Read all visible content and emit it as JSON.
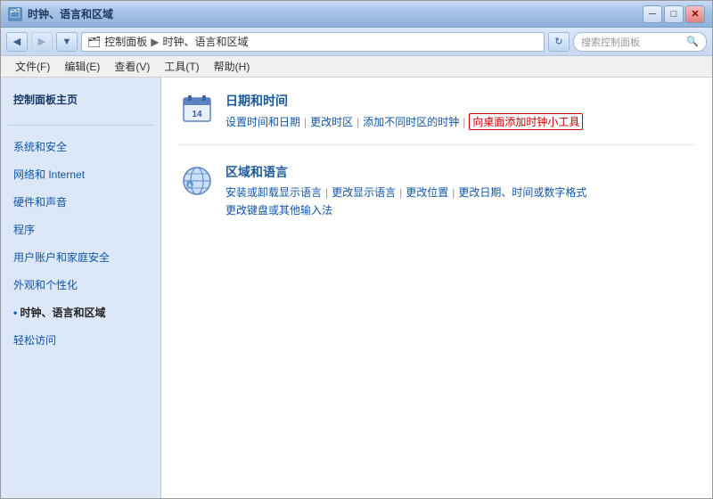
{
  "window": {
    "title": "时钟、语言和区域",
    "title_icon": "🗂"
  },
  "titlebar": {
    "back_btn": "◀",
    "forward_btn": "▶",
    "down_btn": "▼",
    "minimize": "─",
    "maximize": "□",
    "close": "✕"
  },
  "addressbar": {
    "path_prefix": "控制面板",
    "path_separator": "▶",
    "path_current": "时钟、语言和区域",
    "refresh_btn": "↻",
    "search_placeholder": "搜索控制面板",
    "search_icon": "🔍"
  },
  "menubar": {
    "items": [
      {
        "label": "文件(F)"
      },
      {
        "label": "编辑(E)"
      },
      {
        "label": "查看(V)"
      },
      {
        "label": "工具(T)"
      },
      {
        "label": "帮助(H)"
      }
    ]
  },
  "sidebar": {
    "home_label": "控制面板主页",
    "links": [
      {
        "label": "系统和安全",
        "active": false
      },
      {
        "label": "网络和 Internet",
        "active": false
      },
      {
        "label": "硬件和声音",
        "active": false
      },
      {
        "label": "程序",
        "active": false
      },
      {
        "label": "用户账户和家庭安全",
        "active": false
      },
      {
        "label": "外观和个性化",
        "active": false
      },
      {
        "label": "时钟、语言和区域",
        "active": true
      },
      {
        "label": "轻松访问",
        "active": false
      }
    ]
  },
  "content": {
    "panels": [
      {
        "id": "datetime",
        "title": "日期和时间",
        "links": [
          {
            "label": "设置时间和日期",
            "highlighted": false
          },
          {
            "label": "更改时区",
            "highlighted": false
          },
          {
            "label": "添加不同时区的时钟",
            "highlighted": false
          },
          {
            "label": "向桌面添加时钟小工具",
            "highlighted": true
          }
        ],
        "sublinks": []
      },
      {
        "id": "region",
        "title": "区域和语言",
        "links": [
          {
            "label": "安装或卸载显示语言",
            "highlighted": false
          },
          {
            "label": "更改显示语言",
            "highlighted": false
          },
          {
            "label": "更改位置",
            "highlighted": false
          },
          {
            "label": "更改日期、时间或数字格式",
            "highlighted": false
          }
        ],
        "sublinks": [
          {
            "label": "更改键盘或其他输入法",
            "highlighted": false
          }
        ]
      }
    ]
  }
}
